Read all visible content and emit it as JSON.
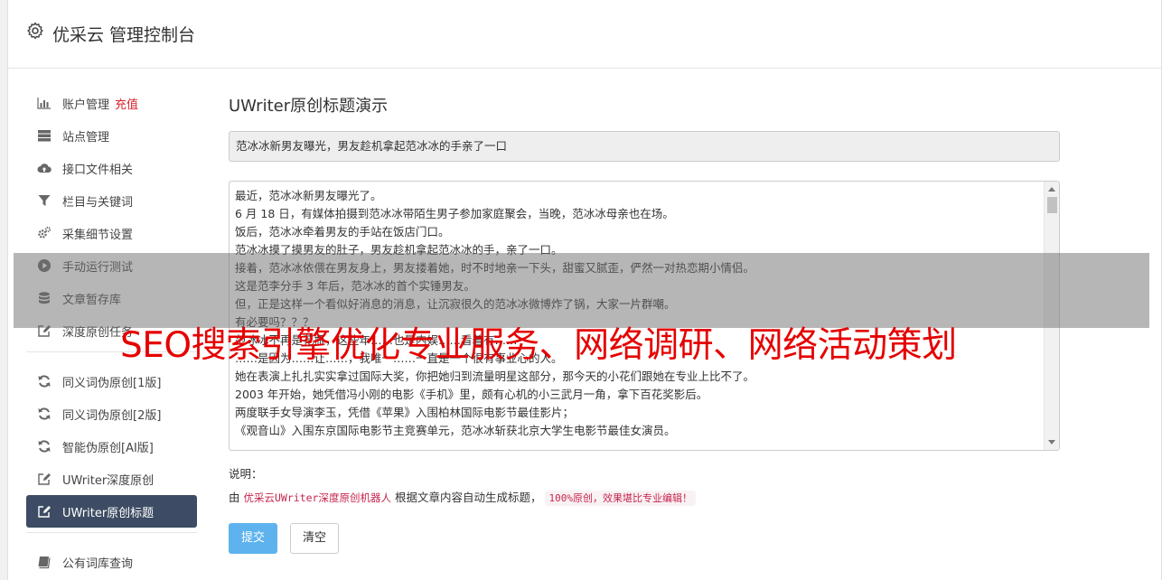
{
  "header": {
    "title": "优采云 管理控制台",
    "icon": "gear-icon"
  },
  "sidebar": {
    "group1": [
      {
        "label": "账户管理",
        "icon": "bar-chart-icon",
        "extra": "充值"
      },
      {
        "label": "站点管理",
        "icon": "server-icon"
      },
      {
        "label": "接口文件相关",
        "icon": "cloud-upload-icon"
      },
      {
        "label": "栏目与关键词",
        "icon": "filter-icon"
      },
      {
        "label": "采集细节设置",
        "icon": "cogs-icon"
      },
      {
        "label": "手动运行测试",
        "icon": "play-circle-icon"
      },
      {
        "label": "文章暂存库",
        "icon": "database-icon"
      },
      {
        "label": "深度原创任务",
        "icon": "edit-icon"
      }
    ],
    "group2": [
      {
        "label": "同义词伪原创[1版]",
        "icon": "refresh-icon"
      },
      {
        "label": "同义词伪原创[2版]",
        "icon": "refresh-icon"
      },
      {
        "label": "智能伪原创[AI版]",
        "icon": "refresh-icon"
      },
      {
        "label": "UWriter深度原创",
        "icon": "edit-icon"
      },
      {
        "label": "UWriter原创标题",
        "icon": "edit-icon",
        "active": true
      }
    ],
    "group3": [
      {
        "label": "公有词库查询",
        "icon": "book-icon"
      }
    ]
  },
  "main": {
    "heading": "UWriter原创标题演示",
    "title_value": "范冰冰新男友曝光，男友趁机拿起范冰冰的手亲了一口",
    "article_lines": [
      "最近，范冰冰新男友曝光了。",
      "6 月 18 日，有媒体拍摄到范冰冰带陌生男子参加家庭聚会，当晚，范冰冰母亲也在场。",
      "饭后，范冰冰牵着男友的手站在饭店门口。",
      "范冰冰摸了摸男友的肚子，男友趁机拿起范冰冰的手，亲了一口。",
      "接着，范冰冰依偎在男友身上，男友搂着她，时不时地亲一下头，甜蜜又腻歪，俨然一对热恋期小情侣。",
      "这是范李分手 3 年后，范冰冰的首个实锤男友。",
      "但，正是这样一个看似好消息的消息，让沉寂很久的范冰冰微博炸了锅，大家一片群嘲。",
      "有必要吗？？？",
      "范冰冰不再是花瓶，这些年……也是内娱……看着有……",
      "……是因为……让……，我唯一……一直是一个很有事业心的人。",
      "她在表演上扎扎实实拿过国际大奖，你把她归到流量明星这部分，那今天的小花们跟她在专业上比不了。",
      "2003 年开始，她凭借冯小刚的电影《手机》里，颇有心机的小三武月一角，拿下百花奖影后。",
      "两度联手女导演李玉，凭借《苹果》入围柏林国际电影节最佳影片；",
      "《观音山》入围东京国际电影节主竞赛单元，范冰冰斩获北京大学生电影节最佳女演员。"
    ],
    "note_label": "说明：",
    "note_prefix": "由",
    "note_robot": "优采云UWriter深度原创机器人",
    "note_middle": "根据文章内容自动生成标题，",
    "note_code": "100%原创，效果堪比专业编辑！",
    "submit_label": "提交",
    "clear_label": "清空"
  },
  "overlay": {
    "banner_text": "SEO搜索引擎优化专业服务、网络调研、网络活动策划"
  },
  "colors": {
    "accent_red": "#d9232d",
    "active_nav": "#3d4c64",
    "submit": "#5eb3ef",
    "banner": "#e50000"
  }
}
